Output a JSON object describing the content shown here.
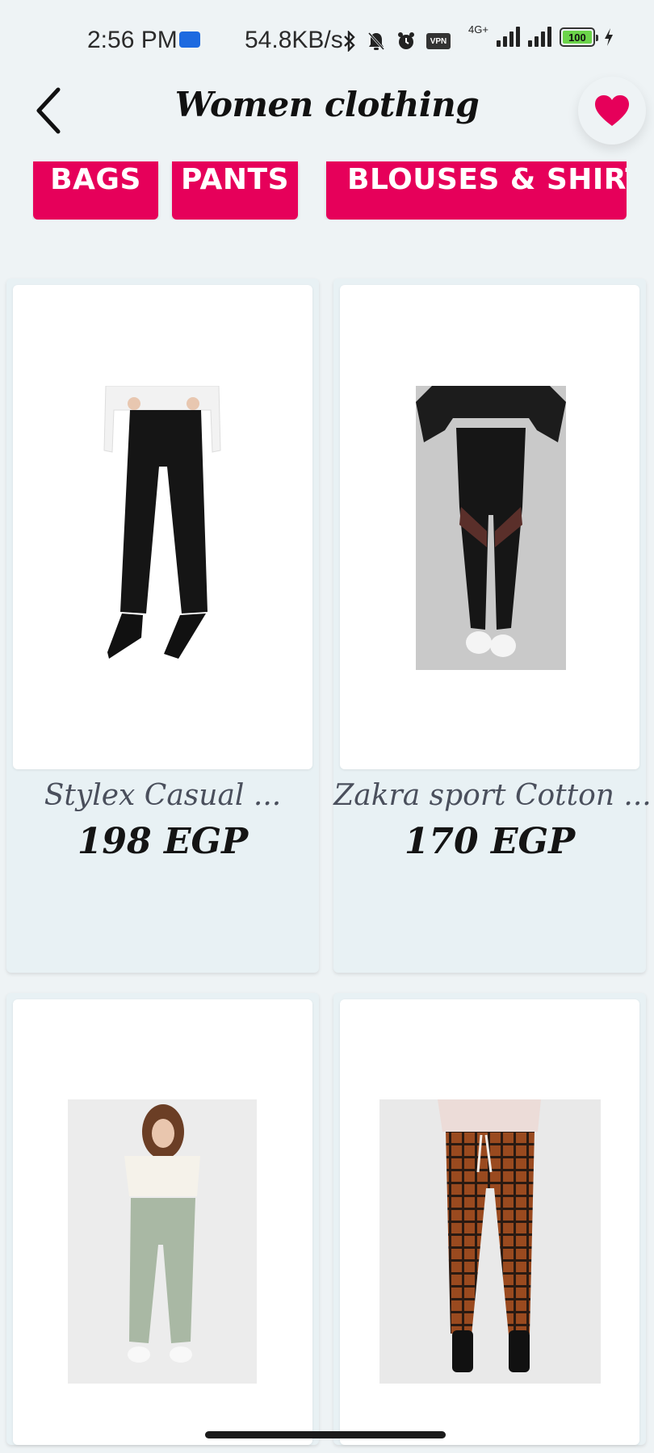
{
  "status_bar": {
    "time": "2:56 PM",
    "speed": "54.8KB/s",
    "vpn": "VPN",
    "network_type": "4G+",
    "battery": "100"
  },
  "header": {
    "title": "Women clothing",
    "back_icon": "chevron-left-icon",
    "favorite_icon": "heart-icon"
  },
  "categories": [
    {
      "label": "BAGS"
    },
    {
      "label": "PANTS"
    },
    {
      "label": "BLOUSES & SHIRTS"
    }
  ],
  "products": [
    {
      "name": "Stylex Casual ...",
      "price": "198 EGP"
    },
    {
      "name": "Zakra sport Cotton ...",
      "price": "170 EGP"
    },
    {
      "name": "",
      "price": ""
    },
    {
      "name": "",
      "price": ""
    }
  ],
  "colors": {
    "accent": "#e6005a",
    "background": "#eef3f5",
    "card": "#e8f1f4"
  }
}
